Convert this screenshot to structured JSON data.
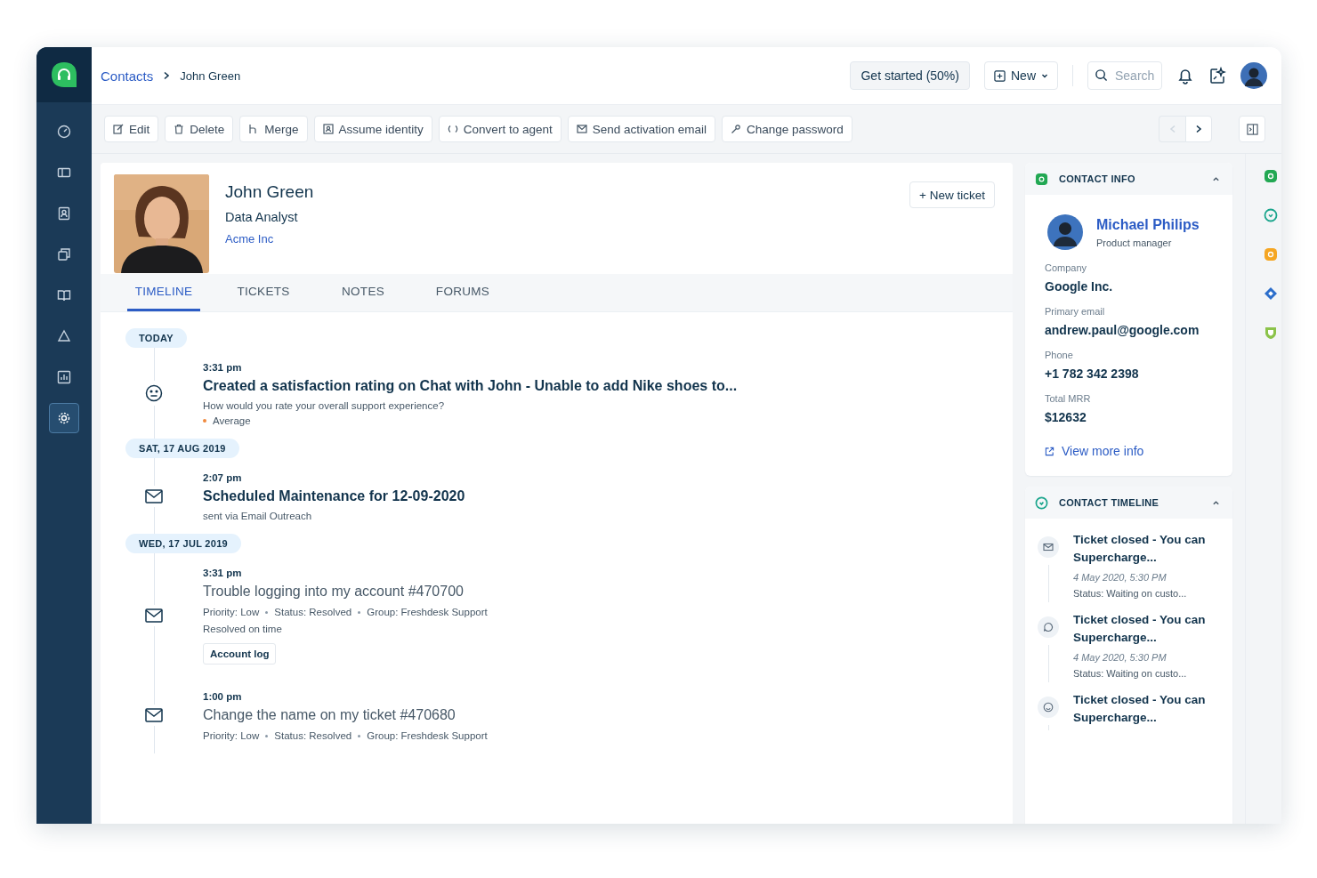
{
  "sidebar": {
    "items": [
      {
        "selected": false
      },
      {
        "selected": false
      },
      {
        "selected": false
      },
      {
        "selected": false
      },
      {
        "selected": false
      },
      {
        "selected": false
      },
      {
        "selected": false
      },
      {
        "selected": true
      }
    ]
  },
  "breadcrumb": [
    "Contacts",
    "John Green"
  ],
  "top_bar": {
    "get_started": "Get started (50%)",
    "new_button": "New",
    "search": {
      "placeholder": "Search"
    }
  },
  "toolbar": {
    "actions": [
      "Edit",
      "Delete",
      "Merge",
      "Assume identity",
      "Convert to agent",
      "Send activation email",
      "Change password"
    ],
    "pager": [
      {
        "kind": "prev",
        "disabled": true
      },
      {
        "kind": "next",
        "disabled": false
      }
    ]
  },
  "contact": {
    "name": "John Green",
    "title": "Data Analyst",
    "company": "Acme Inc",
    "new_ticket": "+ New ticket"
  },
  "tabs": [
    {
      "label": "TIMELINE",
      "selected": true
    },
    {
      "label": "TICKETS",
      "selected": false
    },
    {
      "label": "NOTES",
      "selected": false
    },
    {
      "label": "FORUMS",
      "selected": false
    }
  ],
  "timeline": [
    {
      "date": "TODAY",
      "events": [
        {
          "kind": "rating",
          "unread": true,
          "time": "3:31 pm",
          "title": "Created a satisfaction rating on Chat with John - Unable to add Nike shoes to...",
          "description": "How would you rate your overall support experience?",
          "rating": "Average"
        }
      ]
    },
    {
      "date": "SAT, 17 AUG 2019",
      "events": [
        {
          "kind": "email",
          "unread": true,
          "time": "2:07 pm",
          "title": "Scheduled Maintenance for 12-09-2020",
          "description": "sent via Email Outreach"
        }
      ]
    },
    {
      "date": "WED, 17 JUL 2019",
      "events": [
        {
          "kind": "email",
          "unread": false,
          "time": "3:31 pm",
          "title": "Trouble logging into my account #470700",
          "meta": [
            "Priority: Low",
            "Status: Resolved",
            "Group: Freshdesk Support"
          ],
          "description": "Resolved on time",
          "tag": "Account log"
        },
        {
          "kind": "email",
          "unread": false,
          "time": "1:00 pm",
          "title": "Change the name on my ticket #470680",
          "meta": [
            "Priority: Low",
            "Status: Resolved",
            "Group: Freshdesk Support"
          ]
        }
      ]
    }
  ],
  "contact_info": {
    "header": "CONTACT INFO",
    "expanded": true,
    "person": {
      "name": "Michael Philips",
      "role": "Product manager"
    },
    "fields": [
      {
        "label": "Company",
        "value": "Google Inc."
      },
      {
        "label": "Primary email",
        "value": "andrew.paul@google.com"
      },
      {
        "label": "Phone",
        "value": "+1 782 342 2398"
      },
      {
        "label": "Total MRR",
        "value": "$12632"
      }
    ],
    "link": "View more info"
  },
  "contact_timeline": {
    "header": "CONTACT TIMELINE",
    "expanded": true,
    "items": [
      {
        "kind": "email",
        "title": "Ticket closed - You can Supercharge...",
        "date": "4 May 2020, 5:30 PM",
        "status": "Status: Waiting on custo..."
      },
      {
        "kind": "chat",
        "title": "Ticket closed - You can Supercharge...",
        "date": "4 May 2020, 5:30 PM",
        "status": "Status: Waiting on custo..."
      },
      {
        "kind": "smile",
        "title": "Ticket closed - You can Supercharge..."
      }
    ]
  },
  "apps": [
    {
      "color": "#22a853"
    },
    {
      "color": "#1aa58c"
    },
    {
      "color": "#f5a623"
    },
    {
      "color": "#2c6ecb"
    },
    {
      "color": "#8bc34a"
    }
  ]
}
